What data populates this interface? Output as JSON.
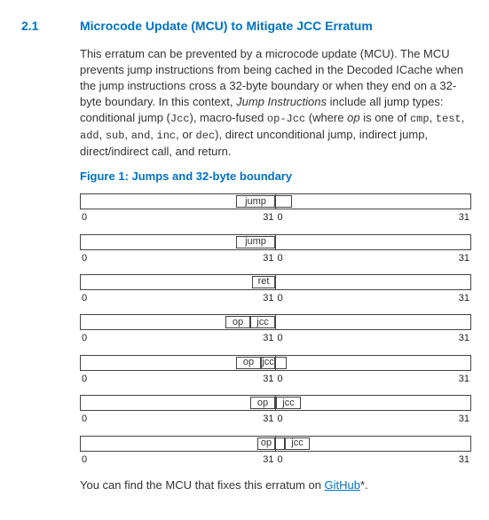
{
  "section_number": "2.1",
  "heading": "Microcode Update (MCU) to Mitigate JCC Erratum",
  "para_before": "This erratum can be prevented by a microcode update (MCU). The MCU prevents jump instructions from being cached in the Decoded ICache when the jump instructions cross a 32-byte boundary or when they end on a 32-byte boundary. In this context, ",
  "ji_italic": "Jump Instructions",
  "para_mid1": " include all jump types: conditional jump (",
  "code_jcc": "Jcc",
  "para_mid2": "), macro-fused ",
  "code_opjcc": "op-Jcc",
  "para_mid3": " (where ",
  "op_italic": "op",
  "para_mid4": " is one of ",
  "code_cmp": "cmp",
  "comma1": ", ",
  "code_test": "test",
  "comma2": ", ",
  "code_add": "add",
  "comma3": ", ",
  "code_sub": "sub",
  "comma4": ", ",
  "code_and": "and",
  "comma5": ", ",
  "code_inc": "inc",
  "para_mid5": ", or ",
  "code_dec": "dec",
  "para_after": "), direct unconditional jump, indirect jump, direct/indirect call, and return.",
  "figure_caption": "Figure 1: Jumps and 32-byte boundary",
  "tick0": "0",
  "tick31": "31",
  "lbl_jump": "jump",
  "lbl_ret": "ret",
  "lbl_op": "op",
  "lbl_jcc": "jcc",
  "foot_before": "You can find the MCU that fixes this erratum on ",
  "foot_link": "GitHub",
  "foot_after": "*."
}
